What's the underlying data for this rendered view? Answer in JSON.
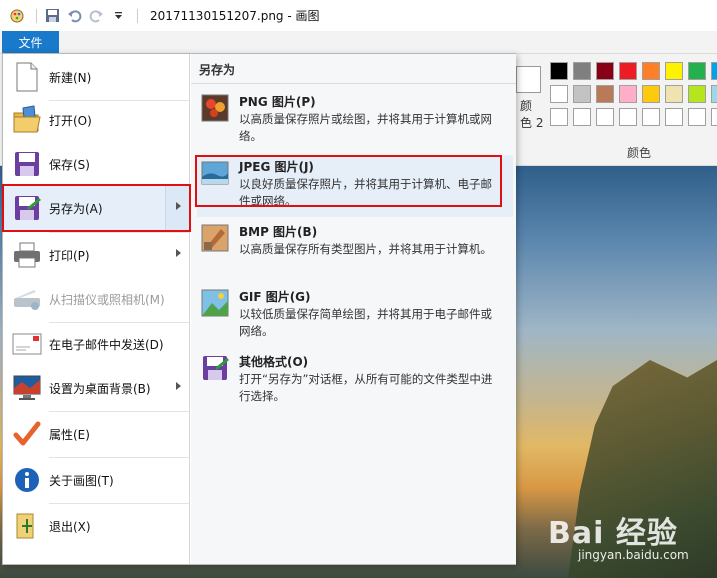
{
  "window": {
    "title": "20171130151207.png - 画图"
  },
  "ribbon": {
    "file_tab": "文件",
    "color2_label_line1": "颜",
    "color2_label_line2": "色 2",
    "colors_group_label": "颜色",
    "palette": [
      "#000000",
      "#7f7f7f",
      "#880015",
      "#ed1c24",
      "#ff7f27",
      "#fff200",
      "#22b14c",
      "#00a2e8",
      "#3f48cc",
      "#ffffff",
      "#c3c3c3",
      "#b97a57",
      "#ffaec9",
      "#ffc90e",
      "#efe4b0",
      "#b5e61d",
      "#99d9ea",
      "#7092be",
      "#ffffff",
      "#ffffff",
      "#ffffff",
      "#ffffff",
      "#ffffff",
      "#ffffff",
      "#ffffff",
      "#ffffff",
      "#ffffff"
    ]
  },
  "file_menu": {
    "items": [
      {
        "label": "新建(N)",
        "icon": "new-file-icon"
      },
      {
        "label": "打开(O)",
        "icon": "open-folder-icon"
      },
      {
        "label": "保存(S)",
        "icon": "floppy-disk-icon"
      },
      {
        "label": "另存为(A)",
        "icon": "save-as-icon"
      },
      {
        "label": "打印(P)",
        "icon": "printer-icon"
      },
      {
        "label": "从扫描仪或照相机(M)",
        "icon": "scanner-icon"
      },
      {
        "label": "在电子邮件中发送(D)",
        "icon": "email-icon"
      },
      {
        "label": "设置为桌面背景(B)",
        "icon": "desktop-icon"
      },
      {
        "label": "属性(E)",
        "icon": "checkmark-icon"
      },
      {
        "label": "关于画图(T)",
        "icon": "info-icon"
      },
      {
        "label": "退出(X)",
        "icon": "exit-icon"
      }
    ],
    "submenu": {
      "header": "另存为",
      "formats": [
        {
          "title": "PNG 图片(P)",
          "desc": "以高质量保存照片或绘图，并将其用于计算机或网络。",
          "icon": "png-image-icon"
        },
        {
          "title": "JPEG 图片(J)",
          "desc": "以良好质量保存照片，并将其用于计算机、电子邮件或网络。",
          "icon": "jpeg-image-icon"
        },
        {
          "title": "BMP 图片(B)",
          "desc": "以高质量保存所有类型图片，并将其用于计算机。",
          "icon": "bmp-image-icon"
        },
        {
          "title": "GIF 图片(G)",
          "desc": "以较低质量保存简单绘图，并将其用于电子邮件或网络。",
          "icon": "gif-image-icon"
        },
        {
          "title": "其他格式(O)",
          "desc": "打开“另存为”对话框，从所有可能的文件类型中进行选择。",
          "icon": "other-formats-icon"
        }
      ]
    }
  },
  "watermark": {
    "brand": "Bai 经验",
    "url": "jingyan.baidu.com"
  },
  "colors": {
    "accent": "#1979ca",
    "highlight_box": "#e01010"
  }
}
